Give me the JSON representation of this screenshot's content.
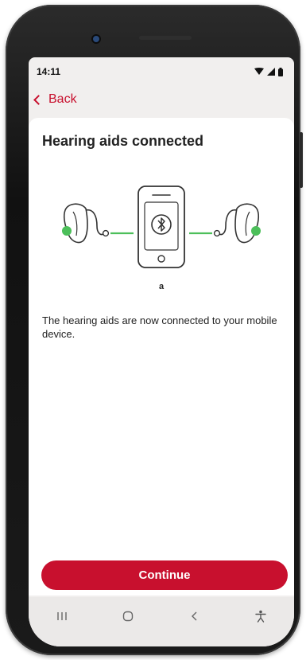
{
  "status_bar": {
    "time": "14:11"
  },
  "nav": {
    "back_label": "Back"
  },
  "page": {
    "title": "Hearing aids connected",
    "device_name": "a",
    "message": "The hearing aids are now connected to your mobile device.",
    "continue_label": "Continue"
  },
  "icons": {
    "wifi": "wifi-icon",
    "signal": "signal-icon",
    "battery": "battery-icon",
    "bluetooth": "bluetooth-icon",
    "recent_apps": "recent-apps-icon",
    "home": "home-icon",
    "back": "back-icon",
    "accessibility": "accessibility-icon"
  },
  "colors": {
    "accent": "#c8102e",
    "connector_green": "#4cbf5a",
    "screen_background": "#f1efee"
  }
}
